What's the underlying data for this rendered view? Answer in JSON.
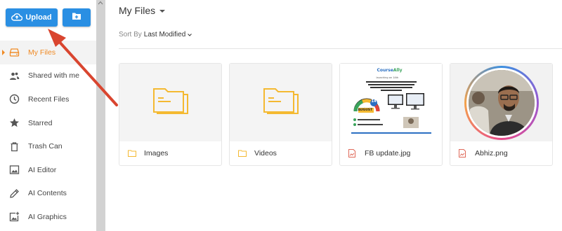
{
  "toolbar": {
    "upload_label": "Upload",
    "accent_color": "#2a8fe3"
  },
  "sidebar": {
    "items": [
      {
        "label": "My Files",
        "icon": "drive-icon",
        "active": true
      },
      {
        "label": "Shared with me",
        "icon": "people-icon"
      },
      {
        "label": "Recent Files",
        "icon": "clock-icon"
      },
      {
        "label": "Starred",
        "icon": "star-icon"
      },
      {
        "label": "Trash Can",
        "icon": "trash-icon"
      },
      {
        "label": "AI Editor",
        "icon": "image-icon"
      },
      {
        "label": "AI Contents",
        "icon": "pencil-icon"
      },
      {
        "label": "AI Graphics",
        "icon": "add-image-icon"
      }
    ],
    "active_color": "#f08a24"
  },
  "header": {
    "title": "My Files"
  },
  "sort": {
    "prefix": "Sort By",
    "value": "Last Modified"
  },
  "files": [
    {
      "name": "Images",
      "type": "folder"
    },
    {
      "name": "Videos",
      "type": "folder"
    },
    {
      "name": "FB update.jpg",
      "type": "image"
    },
    {
      "name": "Abhiz.png",
      "type": "image"
    }
  ],
  "poster": {
    "brand_prefix": "Course",
    "brand_suffix": "Ally",
    "launch_text": "launching on 14th",
    "date_day": "14",
    "date_month": "AUGUST"
  }
}
